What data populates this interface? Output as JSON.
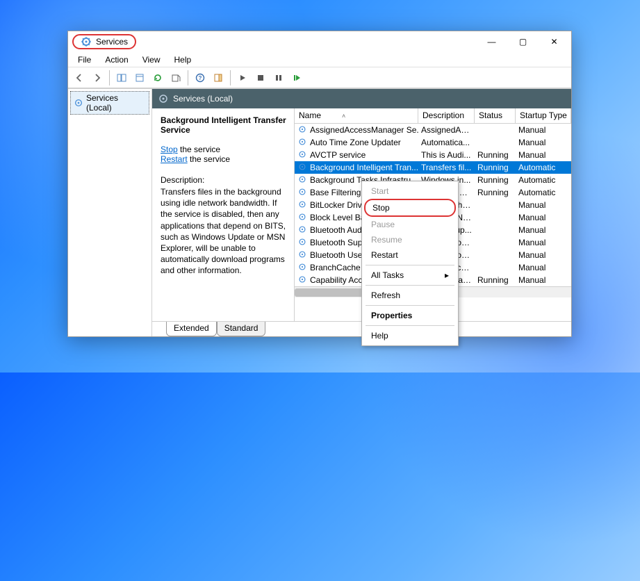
{
  "window": {
    "title": "Services",
    "caption_buttons": {
      "minimize": "—",
      "maximize": "▢",
      "close": "✕"
    }
  },
  "menubar": [
    "File",
    "Action",
    "View",
    "Help"
  ],
  "toolbar_icons": [
    "back",
    "forward",
    "up",
    "detail",
    "refresh",
    "export",
    "help",
    "props",
    "play",
    "stop",
    "pause",
    "restart"
  ],
  "tree": {
    "root": "Services (Local)"
  },
  "content_header": "Services (Local)",
  "detail": {
    "title": "Background Intelligent Transfer Service",
    "stop_link": "Stop",
    "stop_suffix": " the service",
    "restart_link": "Restart",
    "restart_suffix": " the service",
    "desc_label": "Description:",
    "desc": "Transfers files in the background using idle network bandwidth. If the service is disabled, then any applications that depend on BITS, such as Windows Update or MSN Explorer, will be unable to automatically download programs and other information."
  },
  "columns": {
    "name": "Name",
    "desc": "Description",
    "status": "Status",
    "startup": "Startup Type"
  },
  "rows": [
    {
      "name": "AssignedAccessManager Se...",
      "desc": "AssignedAc...",
      "status": "",
      "startup": "Manual"
    },
    {
      "name": "Auto Time Zone Updater",
      "desc": "Automatica...",
      "status": "",
      "startup": "Manual"
    },
    {
      "name": "AVCTP service",
      "desc": "This is Audi...",
      "status": "Running",
      "startup": "Manual"
    },
    {
      "name": "Background Intelligent Tran...",
      "desc": "Transfers fil...",
      "status": "Running",
      "startup": "Automatic",
      "selected": true
    },
    {
      "name": "Background Tasks Infrastru...",
      "desc": "Windows in...",
      "status": "Running",
      "startup": "Automatic"
    },
    {
      "name": "Base Filtering Engine",
      "desc": "The Base Fil...",
      "status": "Running",
      "startup": "Automatic"
    },
    {
      "name": "BitLocker Drive Encryption...",
      "desc": "BDESVC hos...",
      "status": "",
      "startup": "Manual"
    },
    {
      "name": "Block Level Backup Engine...",
      "desc": "The WBENG...",
      "status": "",
      "startup": "Manual"
    },
    {
      "name": "Bluetooth Audio Gateway S...",
      "desc": "Service sup...",
      "status": "",
      "startup": "Manual"
    },
    {
      "name": "Bluetooth Support Service",
      "desc": "The Bluetoo...",
      "status": "",
      "startup": "Manual"
    },
    {
      "name": "Bluetooth User Support Ser...",
      "desc": "The Bluetoo...",
      "status": "",
      "startup": "Manual"
    },
    {
      "name": "BranchCache",
      "desc": "This service...",
      "status": "",
      "startup": "Manual"
    },
    {
      "name": "Capability Access Manager...",
      "desc": "Provides fac...",
      "status": "Running",
      "startup": "Manual"
    }
  ],
  "tabs": {
    "extended": "Extended",
    "standard": "Standard"
  },
  "context_menu": {
    "start": "Start",
    "stop": "Stop",
    "pause": "Pause",
    "resume": "Resume",
    "restart": "Restart",
    "all_tasks": "All Tasks",
    "refresh": "Refresh",
    "properties": "Properties",
    "help": "Help"
  }
}
